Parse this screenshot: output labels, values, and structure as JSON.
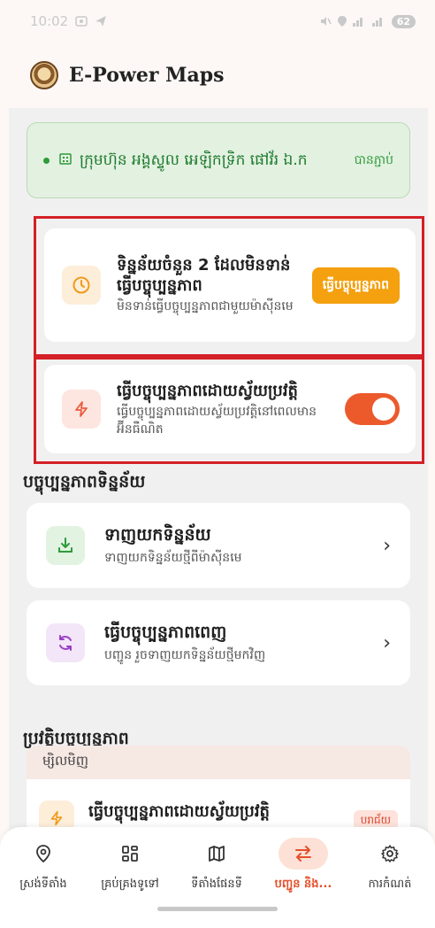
{
  "status_bar": {
    "time": "10:02",
    "battery": "62"
  },
  "app": {
    "title": "E-Power Maps"
  },
  "company": {
    "name": "ក្រុមហ៊ុន អង្គស្ទូល អេឡិកទ្រិក ផៅវ័រ ឯ.ក",
    "status": "បានភ្ជាប់"
  },
  "pending": {
    "title": "ទិន្នន័យចំនួន 2 ដែលមិនទាន់ធ្វើបច្ចុប្បន្នភាព",
    "subtitle": "មិនទាន់ធ្វើបច្ចុប្បន្នភាពជាមួយម៉ាស៊ីនមេ",
    "button": "ធ្វើបច្ចុប្បន្នភាព"
  },
  "auto_sync": {
    "title": "ធ្វើបច្ចុប្បន្នភាពដោយស្វ័យប្រវត្តិ",
    "subtitle": "ធ្វើបច្ចុប្បន្នភាពដោយស្វ័យប្រវត្តិនៅពេលមានអ៊ីនធឺណិត",
    "enabled": true
  },
  "sections": {
    "sync_data": "បច្ចុប្បន្នភាពទិន្នន័យ",
    "history": "ប្រវត្តិបច្ចុប្បន្នភាព"
  },
  "actions": [
    {
      "title": "ទាញយកទិន្នន័យ",
      "subtitle": "ទាញយកទិន្នន័យថ្មីពីម៉ាស៊ីនមេ",
      "icon": "download-icon"
    },
    {
      "title": "ធ្វើបច្ចុប្បន្នភាពពេញ",
      "subtitle": "បញ្ជូន រួចទាញយកទិន្នន័យថ្មីមកវិញ",
      "icon": "refresh-icon"
    }
  ],
  "history": {
    "group_label": "ម្សិលមិញ",
    "item_title": "ធ្វើបច្ចុប្បន្នភាពដោយស្វ័យប្រវត្តិ",
    "item_badge": "បរាជ័យ"
  },
  "nav": [
    {
      "label": "ស្រង់ទីតាំង",
      "icon": "location-pin-icon",
      "active": false
    },
    {
      "label": "គ្រប់គ្រងទូទៅ",
      "icon": "dashboard-grid-icon",
      "active": false
    },
    {
      "label": "ទីតាំងផែនទី",
      "icon": "map-icon",
      "active": false
    },
    {
      "label": "បញ្ជូន និង...",
      "icon": "sync-arrows-icon",
      "active": true
    },
    {
      "label": "ការកំណត់",
      "icon": "gear-icon",
      "active": false
    }
  ],
  "colors": {
    "accent": "#ec5a2c",
    "connected_green": "#2e9b3a",
    "highlight_red": "#d42027",
    "update_orange": "#f4a00f"
  }
}
